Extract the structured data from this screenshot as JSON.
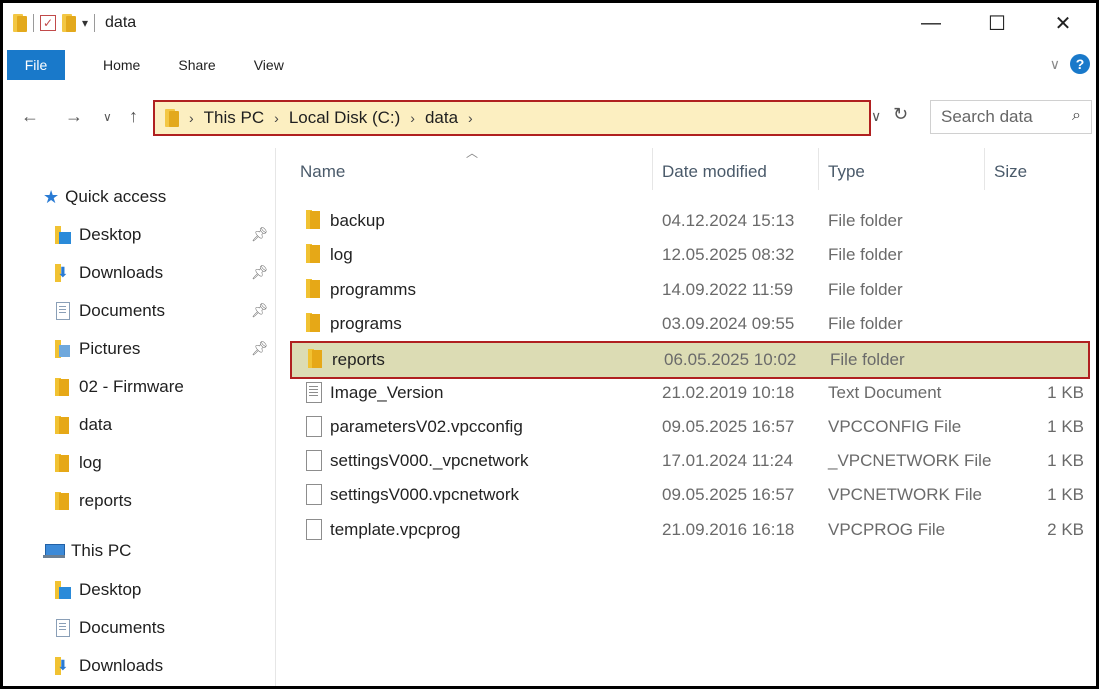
{
  "window": {
    "title": "data",
    "minimize": "—",
    "maximize": "☐",
    "close": "✕"
  },
  "ribbon": {
    "tabs": [
      "File",
      "Home",
      "Share",
      "View"
    ],
    "expand": "∨",
    "help": "?"
  },
  "address": {
    "segments": [
      "This PC",
      "Local Disk (C:)",
      "data"
    ],
    "search_placeholder": "Search data"
  },
  "nav": {
    "quick_access": "Quick access",
    "quick_items": [
      {
        "label": "Desktop",
        "icon": "desktop-icon",
        "pinned": true
      },
      {
        "label": "Downloads",
        "icon": "downloads-icon",
        "pinned": true
      },
      {
        "label": "Documents",
        "icon": "documents-icon",
        "pinned": true
      },
      {
        "label": "Pictures",
        "icon": "pictures-icon",
        "pinned": true
      },
      {
        "label": "02 - Firmware",
        "icon": "folder-icon",
        "pinned": false
      },
      {
        "label": "data",
        "icon": "folder-icon",
        "pinned": false
      },
      {
        "label": "log",
        "icon": "folder-icon",
        "pinned": false
      },
      {
        "label": "reports",
        "icon": "folder-icon",
        "pinned": false
      }
    ],
    "this_pc": "This PC",
    "pc_items": [
      {
        "label": "Desktop",
        "icon": "desktop-icon"
      },
      {
        "label": "Documents",
        "icon": "documents-icon"
      },
      {
        "label": "Downloads",
        "icon": "downloads-icon"
      }
    ]
  },
  "columns": {
    "name": "Name",
    "date": "Date modified",
    "type": "Type",
    "size": "Size"
  },
  "files": [
    {
      "name": "backup",
      "date": "04.12.2024 15:13",
      "type": "File folder",
      "size": "",
      "icon": "folder-icon"
    },
    {
      "name": "log",
      "date": "12.05.2025 08:32",
      "type": "File folder",
      "size": "",
      "icon": "folder-icon"
    },
    {
      "name": "programms",
      "date": "14.09.2022 11:59",
      "type": "File folder",
      "size": "",
      "icon": "folder-icon"
    },
    {
      "name": "programs",
      "date": "03.09.2024 09:55",
      "type": "File folder",
      "size": "",
      "icon": "folder-icon"
    },
    {
      "name": "reports",
      "date": "06.05.2025 10:02",
      "type": "File folder",
      "size": "",
      "icon": "folder-icon",
      "selected": true
    },
    {
      "name": "Image_Version",
      "date": "21.02.2019 10:18",
      "type": "Text Document",
      "size": "1 KB",
      "icon": "text-file-icon"
    },
    {
      "name": "parametersV02.vpcconfig",
      "date": "09.05.2025 16:57",
      "type": "VPCCONFIG File",
      "size": "1 KB",
      "icon": "file-icon"
    },
    {
      "name": "settingsV000._vpcnetwork",
      "date": "17.01.2024 11:24",
      "type": "_VPCNETWORK File",
      "size": "1 KB",
      "icon": "file-icon"
    },
    {
      "name": "settingsV000.vpcnetwork",
      "date": "09.05.2025 16:57",
      "type": "VPCNETWORK File",
      "size": "1 KB",
      "icon": "file-icon"
    },
    {
      "name": "template.vpcprog",
      "date": "21.09.2016 16:18",
      "type": "VPCPROG File",
      "size": "2 KB",
      "icon": "file-icon"
    }
  ],
  "colors": {
    "accent": "#1979ca",
    "address_bg": "#fcefc1",
    "highlight_border": "#b02020",
    "selected_row_bg": "#dcdcb4"
  }
}
